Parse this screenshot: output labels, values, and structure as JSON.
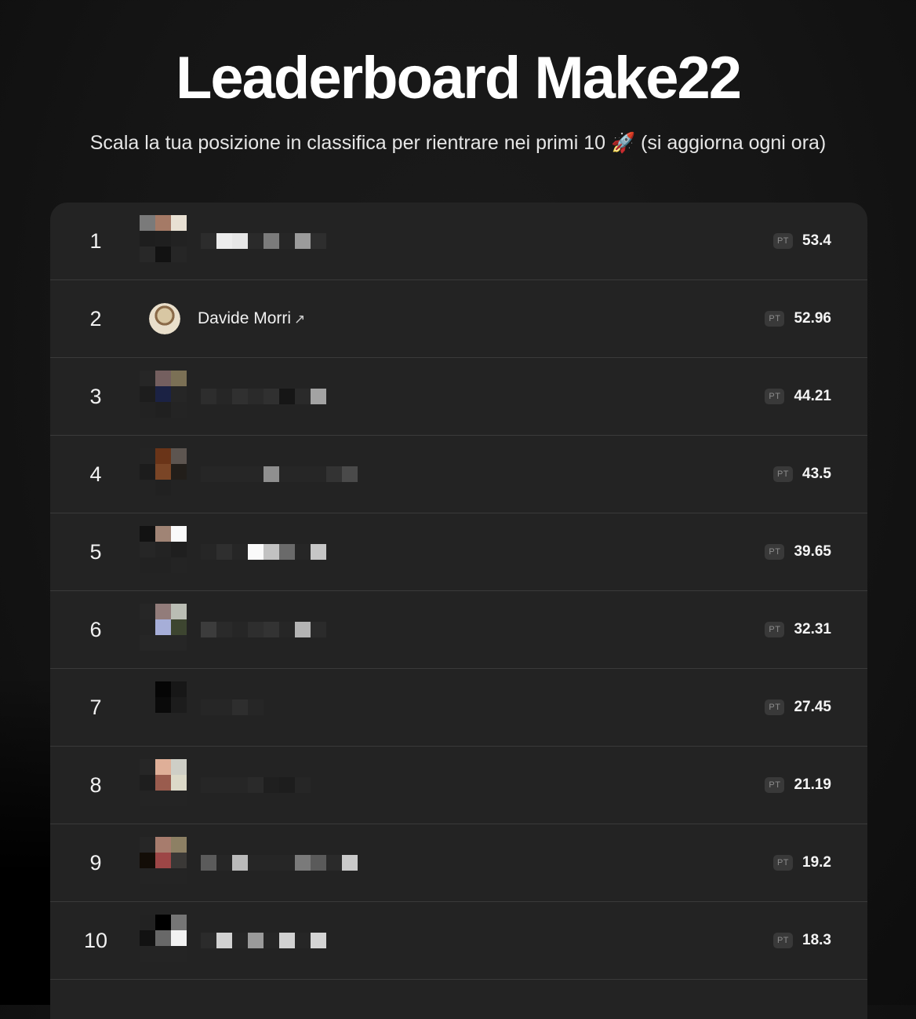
{
  "header": {
    "title": "Leaderboard Make22",
    "subtitle": "Scala la tua posizione in classifica per rientrare nei primi 10 🚀 (si aggiorna ogni ora)"
  },
  "leaderboard": {
    "score_badge": "PT",
    "entries": [
      {
        "rank": "1",
        "name": "",
        "score": "53.4",
        "avatar": [
          "#7a7a7a",
          "#a57a66",
          "#e8e0d3",
          "#1e1e1e",
          "#1f1f1f",
          "#222222",
          "#282828",
          "#121212",
          "#262626"
        ],
        "name_pixels": [
          "#2c2c2c",
          "#ececec",
          "#e6e6e6",
          "#2a2a2a",
          "#7b7b7b",
          "#262626",
          "#9b9b9b",
          "#2e2e2e"
        ]
      },
      {
        "rank": "2",
        "name": "Davide Morri",
        "link_icon": "↗",
        "score": "52.96"
      },
      {
        "rank": "3",
        "name": "",
        "score": "44.21",
        "avatar": [
          "#262626",
          "#745f5f",
          "#7b7055",
          "#1d1d1d",
          "#1b2244",
          "#262626",
          "#222222",
          "#202020",
          "#242424"
        ],
        "name_pixels": [
          "#2d2d2d",
          "#262626",
          "#303030",
          "#2a2a2a",
          "#303030",
          "#161616",
          "#2a2a2a",
          "#a3a3a3"
        ]
      },
      {
        "rank": "4",
        "name": "",
        "score": "43.5",
        "avatar": [
          "#242424",
          "#6a3418",
          "#5d5550",
          "#1c1c1c",
          "#7a4526",
          "#221e1a",
          "#232323",
          "#212121",
          "#232323"
        ],
        "name_pixels": [
          "#262626",
          "#262626",
          "#262626",
          "#262626",
          "#8f8f8f",
          "#262626",
          "#262626",
          "#262626",
          "#333333",
          "#4a4a4a"
        ]
      },
      {
        "rank": "5",
        "name": "",
        "score": "39.65",
        "avatar": [
          "#121212",
          "#a08475",
          "#fafafa",
          "#262626",
          "#232323",
          "#1f1f1f",
          "#222222",
          "#222222",
          "#242424"
        ],
        "name_pixels": [
          "#262626",
          "#2f2f2f",
          "#262626",
          "#fafafa",
          "#c2c2c2",
          "#6a6a6a",
          "#262626",
          "#c6c6c6"
        ]
      },
      {
        "rank": "6",
        "name": "",
        "score": "32.31",
        "avatar": [
          "#262626",
          "#927c7a",
          "#babdb4",
          "#242424",
          "#a6aed8",
          "#3d4530",
          "#262626",
          "#262626",
          "#262626"
        ],
        "name_pixels": [
          "#3c3c3c",
          "#2a2a2a",
          "#262626",
          "#2e2e2e",
          "#333333",
          "#262626",
          "#b4b4b4",
          "#2b2b2b"
        ]
      },
      {
        "rank": "7",
        "name": "",
        "score": "27.45",
        "avatar": [
          "#232323",
          "#050505",
          "#171717",
          "#232323",
          "#0a0a0a",
          "#1c1c1c",
          "#232323",
          "#232323",
          "#232323"
        ],
        "name_pixels": [
          "#262626",
          "#262626",
          "#2e2e2e",
          "#262626"
        ]
      },
      {
        "rank": "8",
        "name": "",
        "score": "21.19",
        "avatar": [
          "#262626",
          "#dfaf98",
          "#cecec6",
          "#1e1e1e",
          "#9a5c4e",
          "#dcd9c8",
          "#242424",
          "#242424",
          "#242424"
        ],
        "name_pixels": [
          "#262626",
          "#262626",
          "#262626",
          "#2a2a2a",
          "#1f1f1f",
          "#1d1d1d",
          "#262626"
        ]
      },
      {
        "rank": "9",
        "name": "",
        "score": "19.2",
        "avatar": [
          "#262626",
          "#a77c6d",
          "#8d8064",
          "#130d07",
          "#9d4646",
          "#3a3836",
          "#242424",
          "#242424",
          "#242424"
        ],
        "name_pixels": [
          "#5b5b5b",
          "#262626",
          "#bababa",
          "#262626",
          "#262626",
          "#262626",
          "#7a7a7a",
          "#5a5a5a",
          "#2a2a2a",
          "#c9c9c9"
        ]
      },
      {
        "rank": "10",
        "name": "",
        "score": "18.3",
        "avatar": [
          "#222222",
          "#000000",
          "#767676",
          "#121212",
          "#686868",
          "#f2f2f2",
          "#242424",
          "#242424",
          "#242424"
        ],
        "name_pixels": [
          "#2b2b2b",
          "#d2d2d2",
          "#262626",
          "#9a9a9a",
          "#262626",
          "#d1d1d1",
          "#262626",
          "#d4d4d4"
        ]
      }
    ]
  }
}
